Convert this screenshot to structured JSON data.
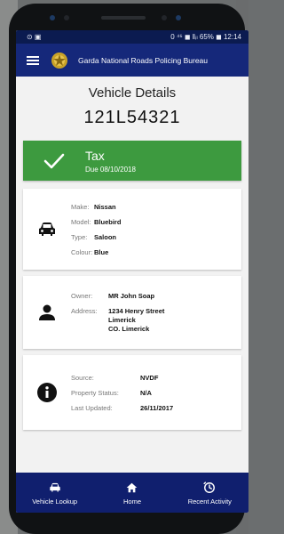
{
  "status_bar": {
    "left": "⊙ ▣",
    "right": "0 ⁴⁶ ◼ ‖ᵢₗ 65% ◼ 12:14"
  },
  "app_bar": {
    "title": "Garda National Roads Policing Bureau",
    "menu_icon": "hamburger-icon",
    "logo": "garda-crest"
  },
  "page": {
    "title": "Vehicle Details",
    "registration": "121L54321"
  },
  "tax": {
    "label": "Tax",
    "due": "Due 08/10/2018",
    "color": "#3d9a3f",
    "icon": "checkmark-icon"
  },
  "vehicle_card": {
    "icon": "car-icon",
    "rows": [
      {
        "label": "Make:",
        "value": "Nissan"
      },
      {
        "label": "Model:",
        "value": "Bluebird"
      },
      {
        "label": "Type:",
        "value": "Saloon"
      },
      {
        "label": "Colour:",
        "value": "Blue"
      }
    ]
  },
  "owner_card": {
    "icon": "person-icon",
    "rows": [
      {
        "label": "Owner:",
        "value": "MR John Soap"
      },
      {
        "label": "Address:",
        "value": "1234 Henry Street\nLimerick\nCO. Limerick"
      }
    ]
  },
  "source_card": {
    "icon": "info-icon",
    "rows": [
      {
        "label": "Source:",
        "value": "NVDF"
      },
      {
        "label": "Property Status:",
        "value": "N/A"
      },
      {
        "label": "Last Updated:",
        "value": "26/11/2017"
      }
    ]
  },
  "bottom_nav": {
    "items": [
      {
        "label": "Vehicle Lookup",
        "icon": "car-icon"
      },
      {
        "label": "Home",
        "icon": "home-icon"
      },
      {
        "label": "Recent Activity",
        "icon": "recent-activity-icon"
      }
    ]
  },
  "colors": {
    "primary": "#15287a",
    "status_bar": "#0b1b50",
    "bottom_nav": "#101f6e",
    "tax_ok": "#3d9a3f"
  }
}
